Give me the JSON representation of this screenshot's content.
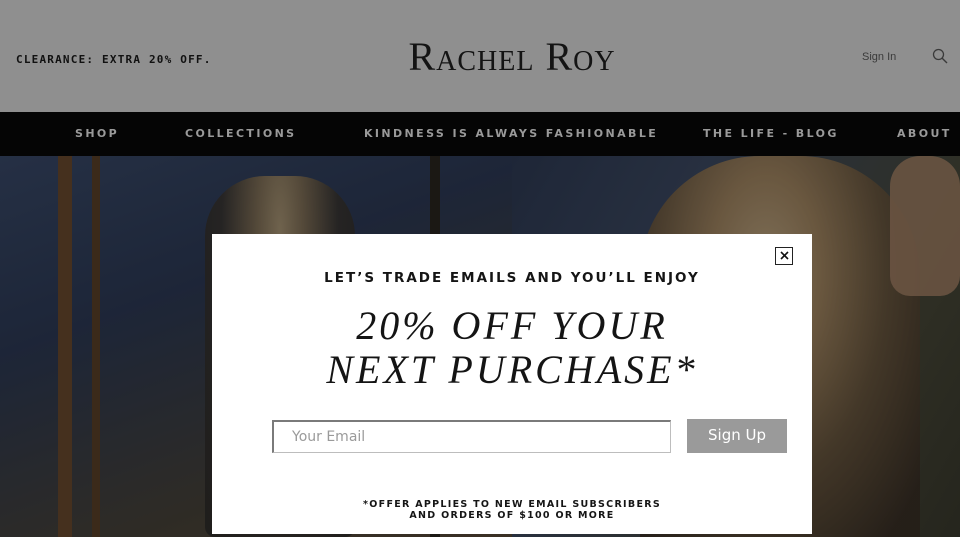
{
  "header": {
    "promo": "CLEARANCE: EXTRA 20% OFF.",
    "logo": "Rachel Roy",
    "sign_in": "Sign In",
    "search_icon": "search-icon"
  },
  "nav": {
    "items": [
      {
        "label": "SHOP"
      },
      {
        "label": "COLLECTIONS"
      },
      {
        "label": "KINDNESS IS ALWAYS FASHIONABLE"
      },
      {
        "label": "THE LIFE - BLOG"
      },
      {
        "label": "ABOUT"
      }
    ]
  },
  "modal": {
    "close_icon": "close-icon",
    "kicker": "LET’S TRADE EMAILS AND YOU’LL ENJOY",
    "headline_line1": "20% OFF YOUR",
    "headline_line2": "NEXT PURCHASE*",
    "email_placeholder": "Your Email",
    "email_value": "",
    "signup_label": "Sign Up",
    "disclaimer_line1": "*OFFER APPLIES TO NEW EMAIL SUBSCRIBERS",
    "disclaimer_line2": "AND ORDERS OF $100 OR MORE"
  },
  "colors": {
    "header_bg": "#8f8f8f",
    "nav_bg": "#050505",
    "nav_text": "#9a9a9a",
    "button_bg": "#9a9a9a"
  }
}
